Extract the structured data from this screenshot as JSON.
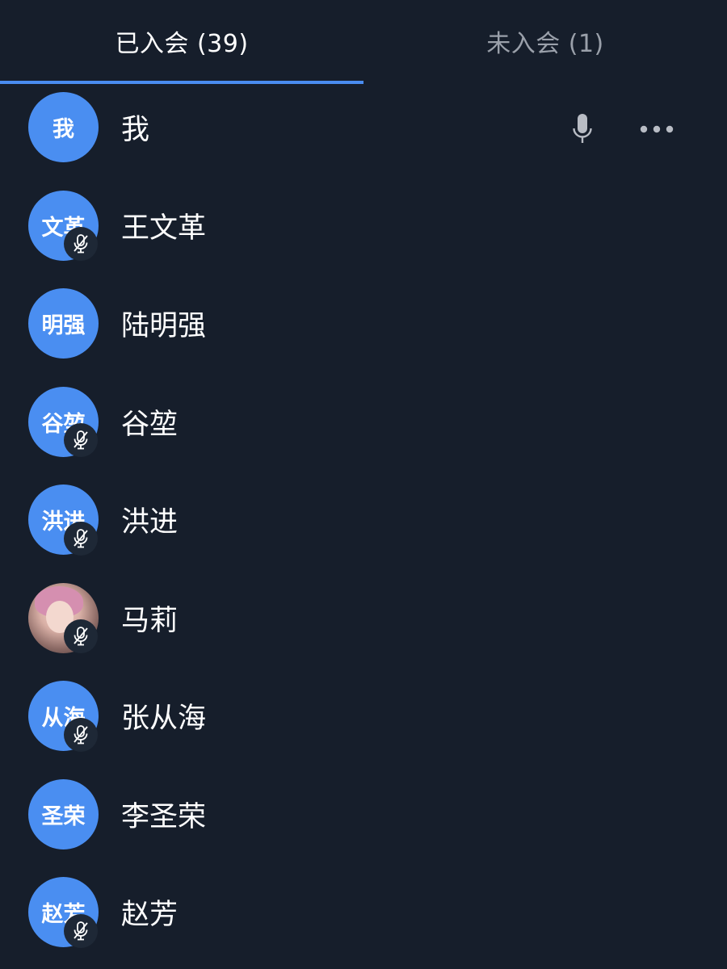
{
  "tabs": [
    {
      "label": "已入会 (39)",
      "active": true
    },
    {
      "label": "未入会 (1)",
      "active": false
    }
  ],
  "participants": [
    {
      "avatar_text": "我",
      "name": "我",
      "muted": false,
      "is_self": true,
      "photo": false
    },
    {
      "avatar_text": "文革",
      "name": "王文革",
      "muted": true,
      "is_self": false,
      "photo": false
    },
    {
      "avatar_text": "明强",
      "name": "陆明强",
      "muted": false,
      "is_self": false,
      "photo": false
    },
    {
      "avatar_text": "谷堃",
      "name": "谷堃",
      "muted": true,
      "is_self": false,
      "photo": false
    },
    {
      "avatar_text": "洪进",
      "name": "洪进",
      "muted": true,
      "is_self": false,
      "photo": false
    },
    {
      "avatar_text": "",
      "name": "马莉",
      "muted": true,
      "is_self": false,
      "photo": true
    },
    {
      "avatar_text": "从海",
      "name": "张从海",
      "muted": true,
      "is_self": false,
      "photo": false
    },
    {
      "avatar_text": "圣荣",
      "name": "李圣荣",
      "muted": false,
      "is_self": false,
      "photo": false
    },
    {
      "avatar_text": "赵芳",
      "name": "赵芳",
      "muted": true,
      "is_self": false,
      "photo": false
    }
  ],
  "icons": {
    "mic": "microphone-icon",
    "more": "more-horizontal-icon",
    "muted": "mic-off-icon"
  },
  "colors": {
    "background": "#161e2b",
    "accent": "#4a8cf0",
    "avatar": "#4a8ef1",
    "inactive_tab": "#9aa0aa"
  }
}
